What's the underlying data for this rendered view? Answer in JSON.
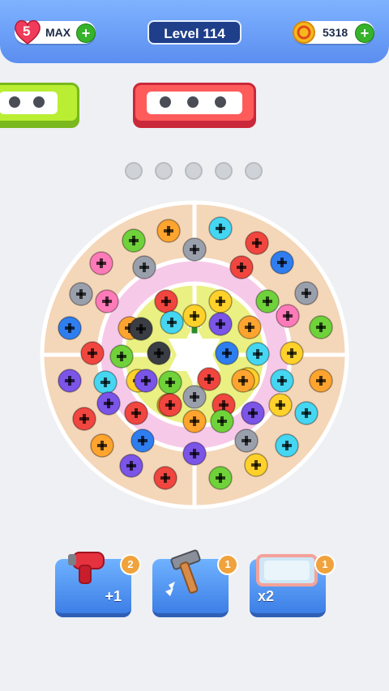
{
  "hud": {
    "lives": "5",
    "lives_status": "MAX",
    "level": "Level 114",
    "coins": "5318"
  },
  "boosters": [
    {
      "label": "+1",
      "count": "2"
    },
    {
      "label": "",
      "count": "1"
    },
    {
      "label": "x2",
      "count": "1"
    }
  ],
  "colors": {
    "accent": "#5b8ef0",
    "outer_ring": "#f4d6b8",
    "pink_ring": "#f7c9e8",
    "yellow_ring": "#eaf082"
  },
  "screws": [
    "green",
    "orange",
    "cyan",
    "red",
    "pink",
    "gray",
    "gray",
    "red",
    "blue",
    "gray",
    "pink",
    "red",
    "yellow",
    "green",
    "gray",
    "blue",
    "orange",
    "cyan",
    "yellow",
    "black",
    "purple",
    "orange",
    "pink",
    "green",
    "red",
    "green",
    "black",
    "blue",
    "cyan",
    "yellow",
    "purple",
    "cyan",
    "yellow",
    "green",
    "red",
    "yellow",
    "cyan",
    "orange",
    "red",
    "purple",
    "red",
    "orange",
    "gray",
    "red",
    "purple",
    "yellow",
    "cyan",
    "orange",
    "blue",
    "purple",
    "gray",
    "cyan",
    "purple",
    "red",
    "green",
    "yellow",
    "orange",
    "red",
    "green",
    "purple",
    "orange"
  ]
}
